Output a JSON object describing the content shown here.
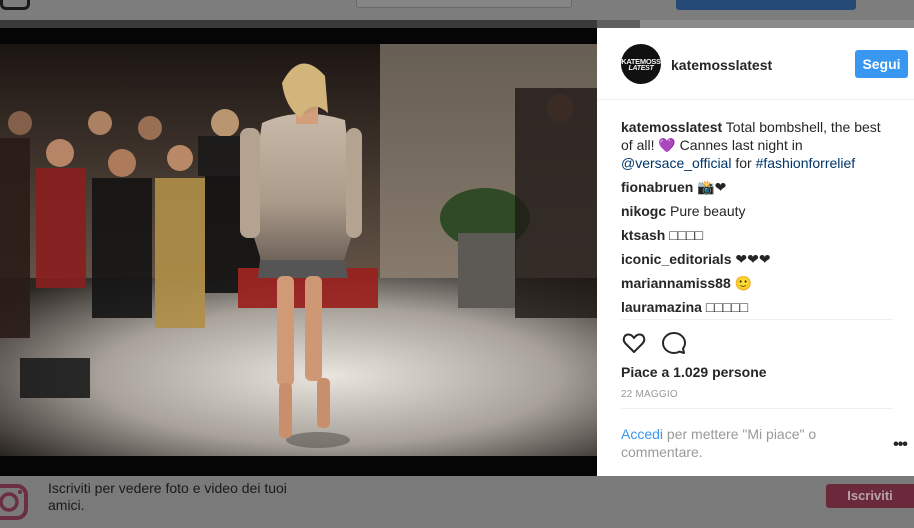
{
  "post": {
    "username": "katemosslatest",
    "avatar_text_line1": "KATEMOSS",
    "avatar_text_line2": "LATEST",
    "follow_label": "Segui",
    "caption": {
      "user": "katemosslatest",
      "text_part1": " Total bombshell, the best of all! 💜 Cannes last night in ",
      "mention": "@versace_official",
      "text_part2": " for ",
      "hashtag": "#fashionforrelief"
    },
    "comments": [
      {
        "user": "fionabruen",
        "text": " 📸❤"
      },
      {
        "user": "nikogc",
        "text": " Pure beauty"
      },
      {
        "user": "ktsash",
        "text": " □□□□"
      },
      {
        "user": "iconic_editorials",
        "text": " ❤❤❤"
      },
      {
        "user": "mariannamiss88",
        "text": " 🙂"
      },
      {
        "user": "lauramazina",
        "text": " □□□□□"
      }
    ],
    "likes_text": "Piace a 1.029 persone",
    "date": "22 MAGGIO",
    "login_link": "Accedi",
    "login_text": " per mettere \"Mi piace\" o commentare.",
    "more_label": "•••",
    "icons": {
      "like": "heart-outline-icon",
      "comment": "speech-bubble-icon",
      "more": "more-options-icon"
    }
  },
  "banner": {
    "text": "Iscriviti per vedere foto e video dei tuoi amici.",
    "button_label": "Iscriviti",
    "logo_icon": "instagram-logo-icon"
  },
  "colors": {
    "accent": "#3897f0",
    "link": "#003569",
    "overlay": "#5f5f5f"
  }
}
